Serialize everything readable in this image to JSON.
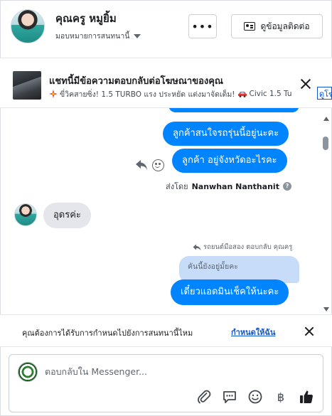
{
  "header": {
    "contact_name": "คุณครู หมูยิ้ม",
    "assign_label": "มอบหมายการสนทนานี้",
    "more_label": "•••",
    "contact_info_label": "ดูข้อมูลติดต่อ"
  },
  "ad_banner": {
    "title": "แชทนี้มีข้อความตอบกลับต่อโฆษณาของคุณ",
    "subtitle_part1": "ขี่วิคสายซิ่ง! 1.5 TURBO แรง ประหยัด แต่งมาจัดเต็ม!",
    "subtitle_part2": "Civic 1.5 Tu",
    "link_label": "ดูโฆษณา"
  },
  "conversation": {
    "messages_out": [
      "ลูกค้าสนใจรถรุ่นนี้อยู่นะคะ",
      "ลูกค้า อยู่จังหวัดอะไรคะ"
    ],
    "sent_by_prefix": "ส่งโดย",
    "sent_by_name": "Nanwhan Nanthanit",
    "incoming_message": "อุดรค่ะ",
    "replied_label": "รถยนต์มือสอง ตอบกลับ คุณครู",
    "quoted_message": "คันนี้ยังอยู่มั้ยคะ",
    "last_message": "เดี๋ยวแอดมินเช็คให้นะคะ"
  },
  "suggestion": {
    "text": "คุณต้องการได้รับการกำหนดไปยังการสนทนานี้ไหม",
    "link": "กำหนดให้ฉัน"
  },
  "composer": {
    "placeholder": "ตอบกลับใน Messenger..."
  },
  "colors": {
    "accent": "#0084ff",
    "link": "#1155cc",
    "incoming_bubble": "#e4e6eb",
    "quoted_bubble": "#c7dcf9"
  }
}
